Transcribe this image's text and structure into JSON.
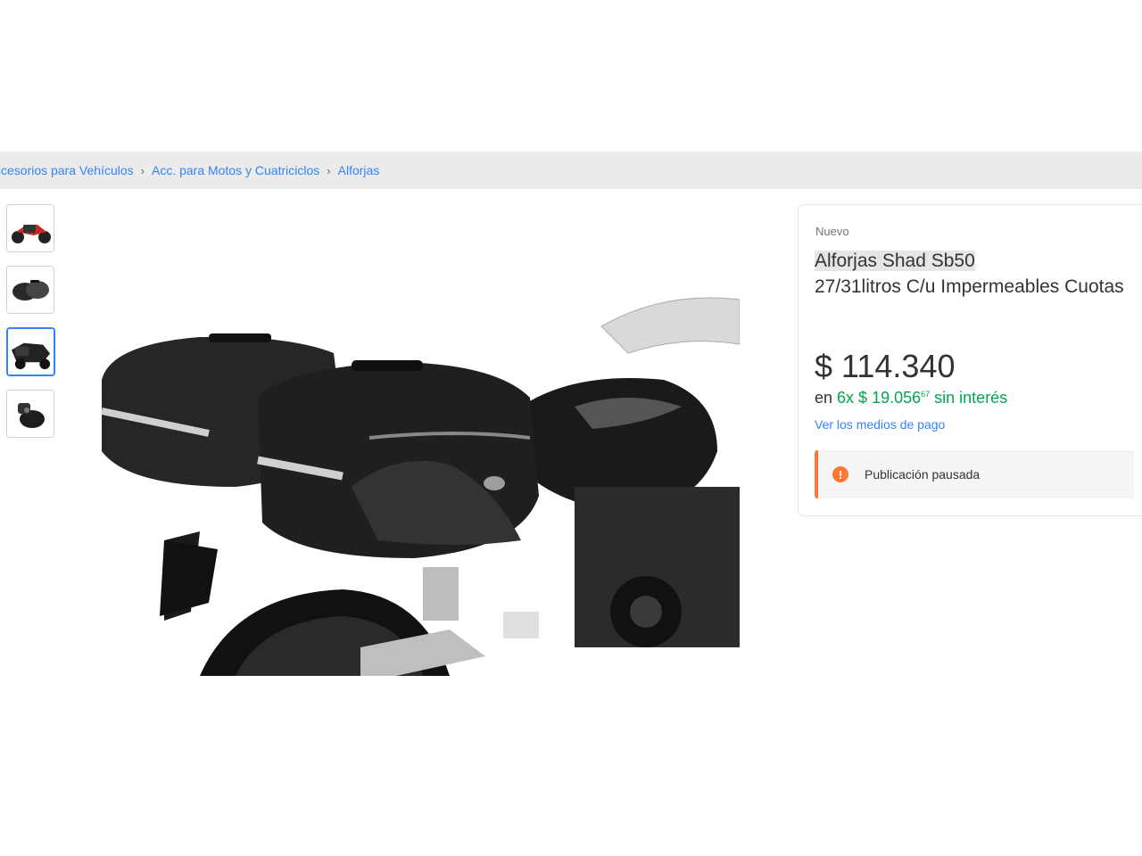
{
  "breadcrumb": {
    "items": [
      "ccesorios para Vehículos",
      "Acc. para Motos y Cuatriciclos",
      "Alforjas"
    ],
    "separator": "›"
  },
  "gallery": {
    "thumbnails": [
      "motorcycle-side-thumbnail",
      "saddlebags-thumbnail",
      "saddlebags-on-bike-thumbnail",
      "saddlebag-detail-thumbnail"
    ],
    "active_index": 2
  },
  "product": {
    "condition": "Nuevo",
    "title_highlight": "Alforjas Shad Sb50",
    "title_rest": "27/31litros C/u Impermeables Cuotas",
    "price": "$ 114.340",
    "installments_prefix": "en",
    "installments_amount": "6x $ 19.056",
    "installments_cents": "67",
    "installments_suffix": "sin interés",
    "payment_link": "Ver los medios de pago",
    "notice_icon": "!",
    "notice_text": "Publicación pausada"
  },
  "colors": {
    "link": "#3483fa",
    "green": "#00a650",
    "warning": "#ff7733"
  }
}
